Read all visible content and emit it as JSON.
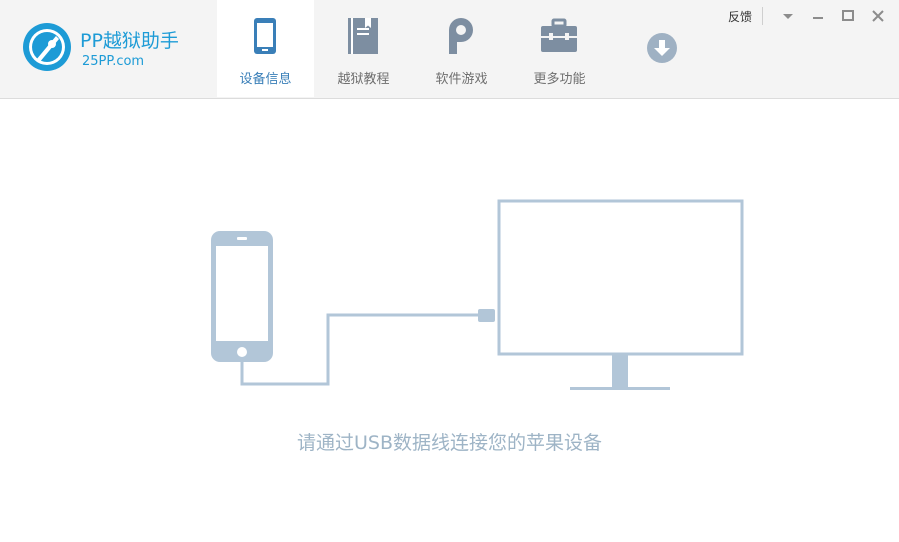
{
  "brand": {
    "name": "PP越狱助手",
    "site": "25PP.com"
  },
  "tabs": [
    {
      "label": "设备信息",
      "icon": "phone-icon",
      "active": true
    },
    {
      "label": "越狱教程",
      "icon": "book-icon",
      "active": false
    },
    {
      "label": "软件游戏",
      "icon": "pp-logo-icon",
      "active": false
    },
    {
      "label": "更多功能",
      "icon": "toolbox-icon",
      "active": false
    }
  ],
  "window": {
    "feedback_label": "反馈"
  },
  "main": {
    "hint": "请通过USB数据线连接您的苹果设备"
  },
  "colors": {
    "brand": "#1d9bd6",
    "icon_gray": "#7d8ea1",
    "illustration": "#b2c6d8",
    "hint_text": "#9eb4c6"
  }
}
